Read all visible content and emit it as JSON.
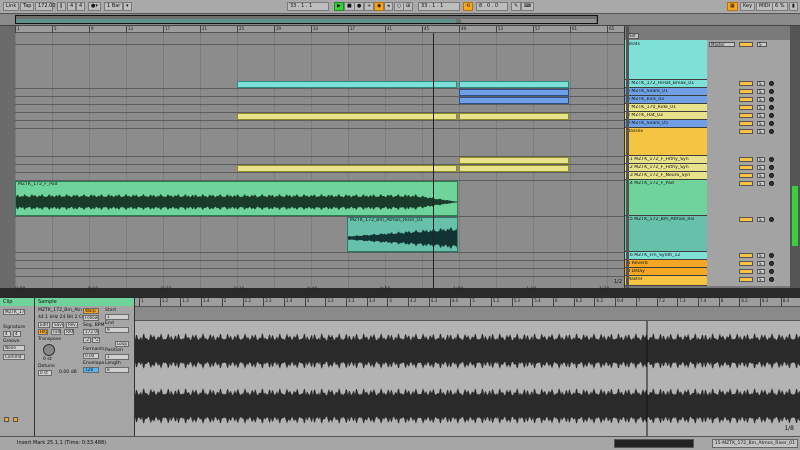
{
  "transport": {
    "link": "Link",
    "tap": "Tap",
    "tempo": "172.00",
    "sig_num": "4",
    "sig_den": "4",
    "quant": "1 Bar",
    "pos": "33 . 1 . 1",
    "loop_start": "33 . 1 . 1",
    "loop_len": "8 . 0 . 0",
    "key": "Key",
    "midi": "MIDI",
    "cpu": "6 %"
  },
  "ruler_marks": [
    "1",
    "5",
    "9",
    "13",
    "17",
    "21",
    "25",
    "29",
    "33",
    "37",
    "41",
    "45",
    "49",
    "53",
    "57",
    "61",
    "65"
  ],
  "ruler_times": [
    "0:00",
    "0:10",
    "0:20",
    "0:30",
    "0:40",
    "0:50",
    "1:00",
    "1:10",
    "1:20"
  ],
  "set_label": "Set",
  "tracks": [
    {
      "name": "4 MZTK_172_HiHat_Break_01",
      "color": "#7fe0d8"
    },
    {
      "name": "5 MZTK_Snare_01",
      "color": "#6fa0e6"
    },
    {
      "name": "6 MZTK_Kick_02",
      "color": "#6fa0e6"
    },
    {
      "name": "7 MZTK_170_Ride_01",
      "color": "#e8e28a"
    },
    {
      "name": "8 MZTK_Hat_03",
      "color": "#e8e28a"
    },
    {
      "name": "9 MZTK_Snare_05",
      "color": "#6fa0e6"
    },
    {
      "name": "Basses",
      "color": "#f5c542"
    },
    {
      "name": "11 MZTK_172_F_Filthy_Syn",
      "color": "#e8e28a"
    },
    {
      "name": "12 MZTK_172_F_Filthy_Syn",
      "color": "#e8e28a"
    },
    {
      "name": "13 MZTK_172_F_Neuro_Syn",
      "color": "#e8e28a"
    },
    {
      "name": "14 MZTK_172_F_Pad",
      "color": "#6fd49b"
    },
    {
      "name": "15 MZTK_172_Bm_Atmos_Ris",
      "color": "#66c0aa"
    },
    {
      "name": "16 MZTK_Fm_Synth_12",
      "color": "#7fe0d8"
    },
    {
      "name": "A Reverb",
      "color": "#f5a623"
    },
    {
      "name": "B Delay",
      "color": "#f5a623"
    },
    {
      "name": "Master",
      "color": "#f5c542"
    }
  ],
  "group_label": "Beats",
  "master_label": "Master",
  "clips": {
    "pad": "MZTK_172_F_Pad",
    "atmos": "MZTK_172_Bm_Atmos_Riser_01",
    "page_indicator": "1/2"
  },
  "clip_panel": {
    "header": "Clip",
    "clip_name": "MZTK_172_...",
    "signature_label": "Signature",
    "sig_num": "4",
    "sig_den": "4",
    "groove_label": "Groove",
    "groove_val": "None",
    "commit": "Commit"
  },
  "sample_panel": {
    "header": "Sample",
    "file": "MZTK_172_Bm_Atn",
    "info": "44.1 kHz 24 Bit 2 Ch",
    "warp": "Warp",
    "follower": "Follower",
    "edit": "Edit",
    "save": "Save",
    "rev": "Rev.",
    "hiq": "HiQ",
    "fade": "Fade",
    "ram": "RAM",
    "seg_bpm_label": "Seg. BPM",
    "seg_bpm": "172.00",
    "half": ":2",
    "double": "*2",
    "transpose_label": "Transpose",
    "transpose": "0 st",
    "detune_label": "Detune",
    "detune": "0 ct",
    "gain": "0.00 dB",
    "start_label": "Start",
    "start": "1",
    "end_label": "End",
    "end": "9",
    "loop": "Loop",
    "position_label": "Position",
    "position": "1",
    "length_label": "Length",
    "length": "8",
    "formants_label": "Formants",
    "formants": "0.00",
    "envelope_label": "Envelope",
    "envelope": "128"
  },
  "sample_ruler": [
    "1",
    "1.2",
    "1.3",
    "1.4",
    "2",
    "2.2",
    "2.3",
    "2.4",
    "3",
    "3.2",
    "3.3",
    "3.4",
    "4",
    "4.2",
    "4.3",
    "4.4",
    "5",
    "5.2",
    "5.3",
    "5.4",
    "6",
    "6.2",
    "6.3",
    "6.4",
    "7",
    "7.2",
    "7.3",
    "7.4",
    "8",
    "8.2",
    "8.3",
    "8.4"
  ],
  "detail_page": "1/8",
  "status": {
    "text": "Insert Mark 25.1.1 (Time: 0:33.488)",
    "track": "15-MZTK_172_Bm_Atmos_Riser_01"
  },
  "colors": {
    "cyan": "#7fe0d8",
    "blue": "#6fa0e6",
    "yellow": "#e8e28a",
    "green": "#6fd49b",
    "orange": "#f5a623",
    "play": "#3bd03b"
  }
}
